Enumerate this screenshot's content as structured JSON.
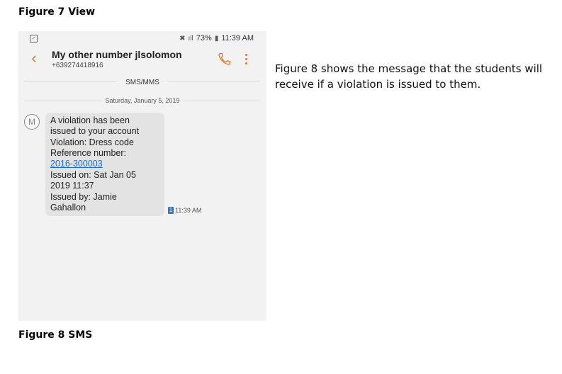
{
  "document": {
    "figure7_title": "Figure 7 View",
    "figure8_title": "Figure 8 SMS",
    "caption": "Figure 8 shows the message that the students will receive if a violation is issued to them."
  },
  "phone": {
    "status_bar": {
      "battery": "73%",
      "time": "11:39 AM"
    },
    "header": {
      "contact_name": "My other number jlsolomon",
      "contact_number": "+639274418916"
    },
    "separator_label": "SMS/MMS",
    "date_label": "Saturday, January 5, 2019",
    "avatar_letter": "M",
    "message": {
      "lines": [
        "A violation has been",
        "issued to your account",
        "Violation: Dress code",
        "Reference number:",
        "2016-300003",
        "Issued on: Sat Jan 05",
        "2019 11:37",
        "Issued by: Jamie",
        "Gahallon"
      ],
      "time": "11:39 AM",
      "sim": "1"
    },
    "colors": {
      "accent": "#e07a1f",
      "link": "#1a6fc9",
      "bubble": "#e3e3e3"
    }
  }
}
